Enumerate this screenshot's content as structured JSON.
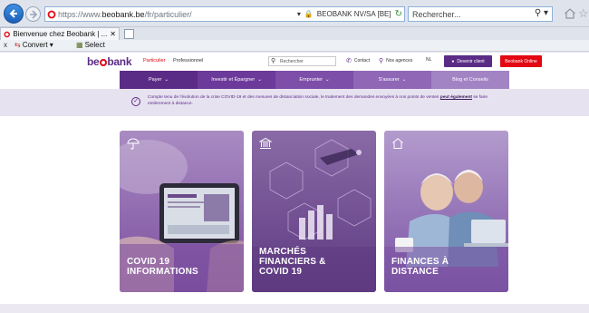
{
  "browser": {
    "url_prefix": "https://www.",
    "url_domain": "beobank.be",
    "url_path": "/fr/particulier/",
    "cert_label": "BEOBANK NV/SA [BE]",
    "search_placeholder": "Rechercher...",
    "tab_title": "Bienvenue chez Beobank | ...",
    "toolbar": {
      "close_glyph": "x",
      "convert_label": "Convert",
      "select_label": "Select"
    }
  },
  "header": {
    "logo_left": "be",
    "logo_right": "bank",
    "segment_particulier": "Particulier",
    "segment_professionnel": "Professionnel",
    "search_placeholder": "Rechercher",
    "contact": "Contact",
    "agencies": "Nos agences",
    "language": "NL",
    "become_client": "Devenir client",
    "online": "Beobank Online"
  },
  "nav": {
    "items": [
      {
        "label": "Payer",
        "color": "#5b2c86"
      },
      {
        "label": "Investir et Épargner",
        "color": "#6c3a9a"
      },
      {
        "label": "Emprunter",
        "color": "#7d4fa8"
      },
      {
        "label": "S'assurer",
        "color": "#8f67b6"
      },
      {
        "label": "Blog et Conseils",
        "color": "#a283c4"
      }
    ]
  },
  "notice": {
    "text_line1": "Compte tenu de l'évolution de la crise COVID-19 et des mesures de distanciation sociale, le traitement des demandes envoyées à nos points de ventes",
    "link": "peut également",
    "text_line2": "se faire entièrement à distance."
  },
  "cards": [
    {
      "icon": "umbrella-icon",
      "title_line1": "COVID 19",
      "title_line2": "INFORMATIONS",
      "title_line3": ""
    },
    {
      "icon": "bank-icon",
      "title_line1": "MARCHÉS",
      "title_line2": "FINANCIERS &",
      "title_line3": "COVID 19"
    },
    {
      "icon": "house-icon",
      "title_line1": "FINANCES À",
      "title_line2": "DISTANCE",
      "title_line3": ""
    }
  ],
  "colors": {
    "brand_purple": "#5b2c86",
    "brand_red": "#e30613"
  }
}
